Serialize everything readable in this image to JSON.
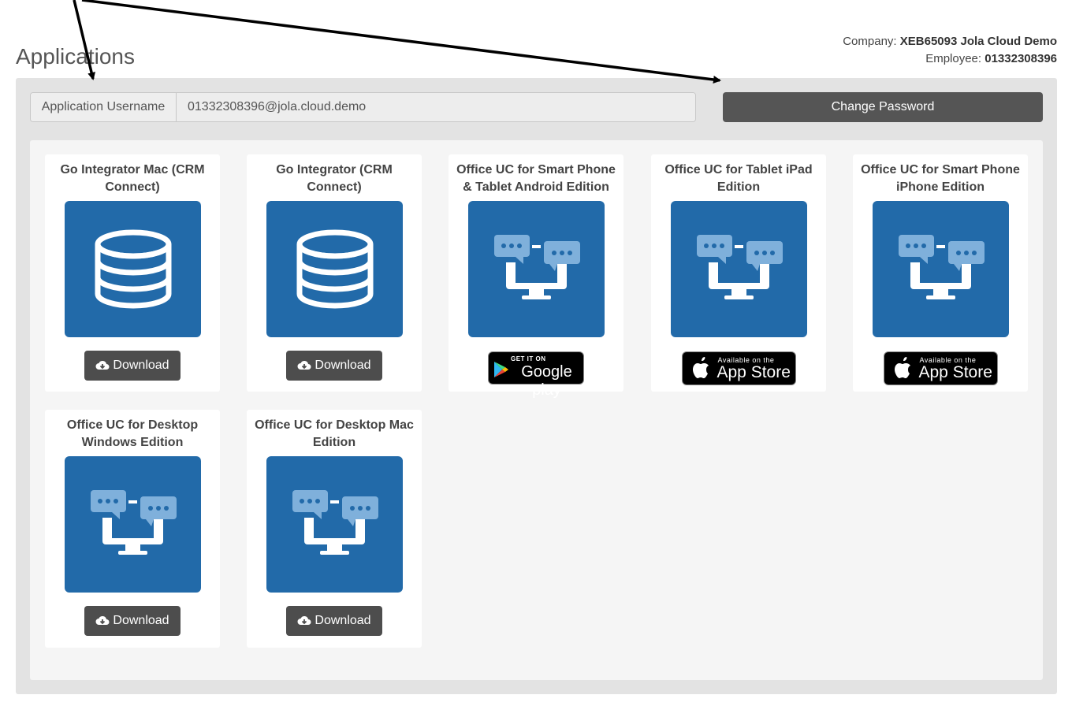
{
  "page": {
    "title": "Applications"
  },
  "company_info": {
    "company_label": "Company:",
    "company_value": "XEB65093 Jola Cloud Demo",
    "employee_label": "Employee:",
    "employee_value": "01332308396"
  },
  "username": {
    "label": "Application Username",
    "value": "01332308396@jola.cloud.demo"
  },
  "change_password_label": "Change Password",
  "download_label": "Download",
  "badges": {
    "google_small": "GET IT ON",
    "google_big": "Google play",
    "apple_small": "Available on the",
    "apple_big": "App Store"
  },
  "apps": [
    {
      "title": "Go Integrator Mac (CRM Connect)",
      "icon": "database-icon",
      "action": "download"
    },
    {
      "title": "Go Integrator (CRM Connect)",
      "icon": "database-icon",
      "action": "download"
    },
    {
      "title": "Office UC for Smart Phone & Tablet Android Edition",
      "icon": "chat-desktop-icon",
      "action": "google-play"
    },
    {
      "title": "Office UC for Tablet iPad Edition",
      "icon": "chat-desktop-icon",
      "action": "app-store"
    },
    {
      "title": "Office UC for Smart Phone iPhone Edition",
      "icon": "chat-desktop-icon",
      "action": "app-store"
    },
    {
      "title": "Office UC for Desktop Windows Edition",
      "icon": "chat-desktop-icon",
      "action": "download"
    },
    {
      "title": "Office UC for Desktop Mac Edition",
      "icon": "chat-desktop-icon",
      "action": "download"
    }
  ],
  "colors": {
    "icon_bg": "#226aa9",
    "button_bg": "#4d4d4d",
    "panel_bg": "#e3e3e3"
  }
}
